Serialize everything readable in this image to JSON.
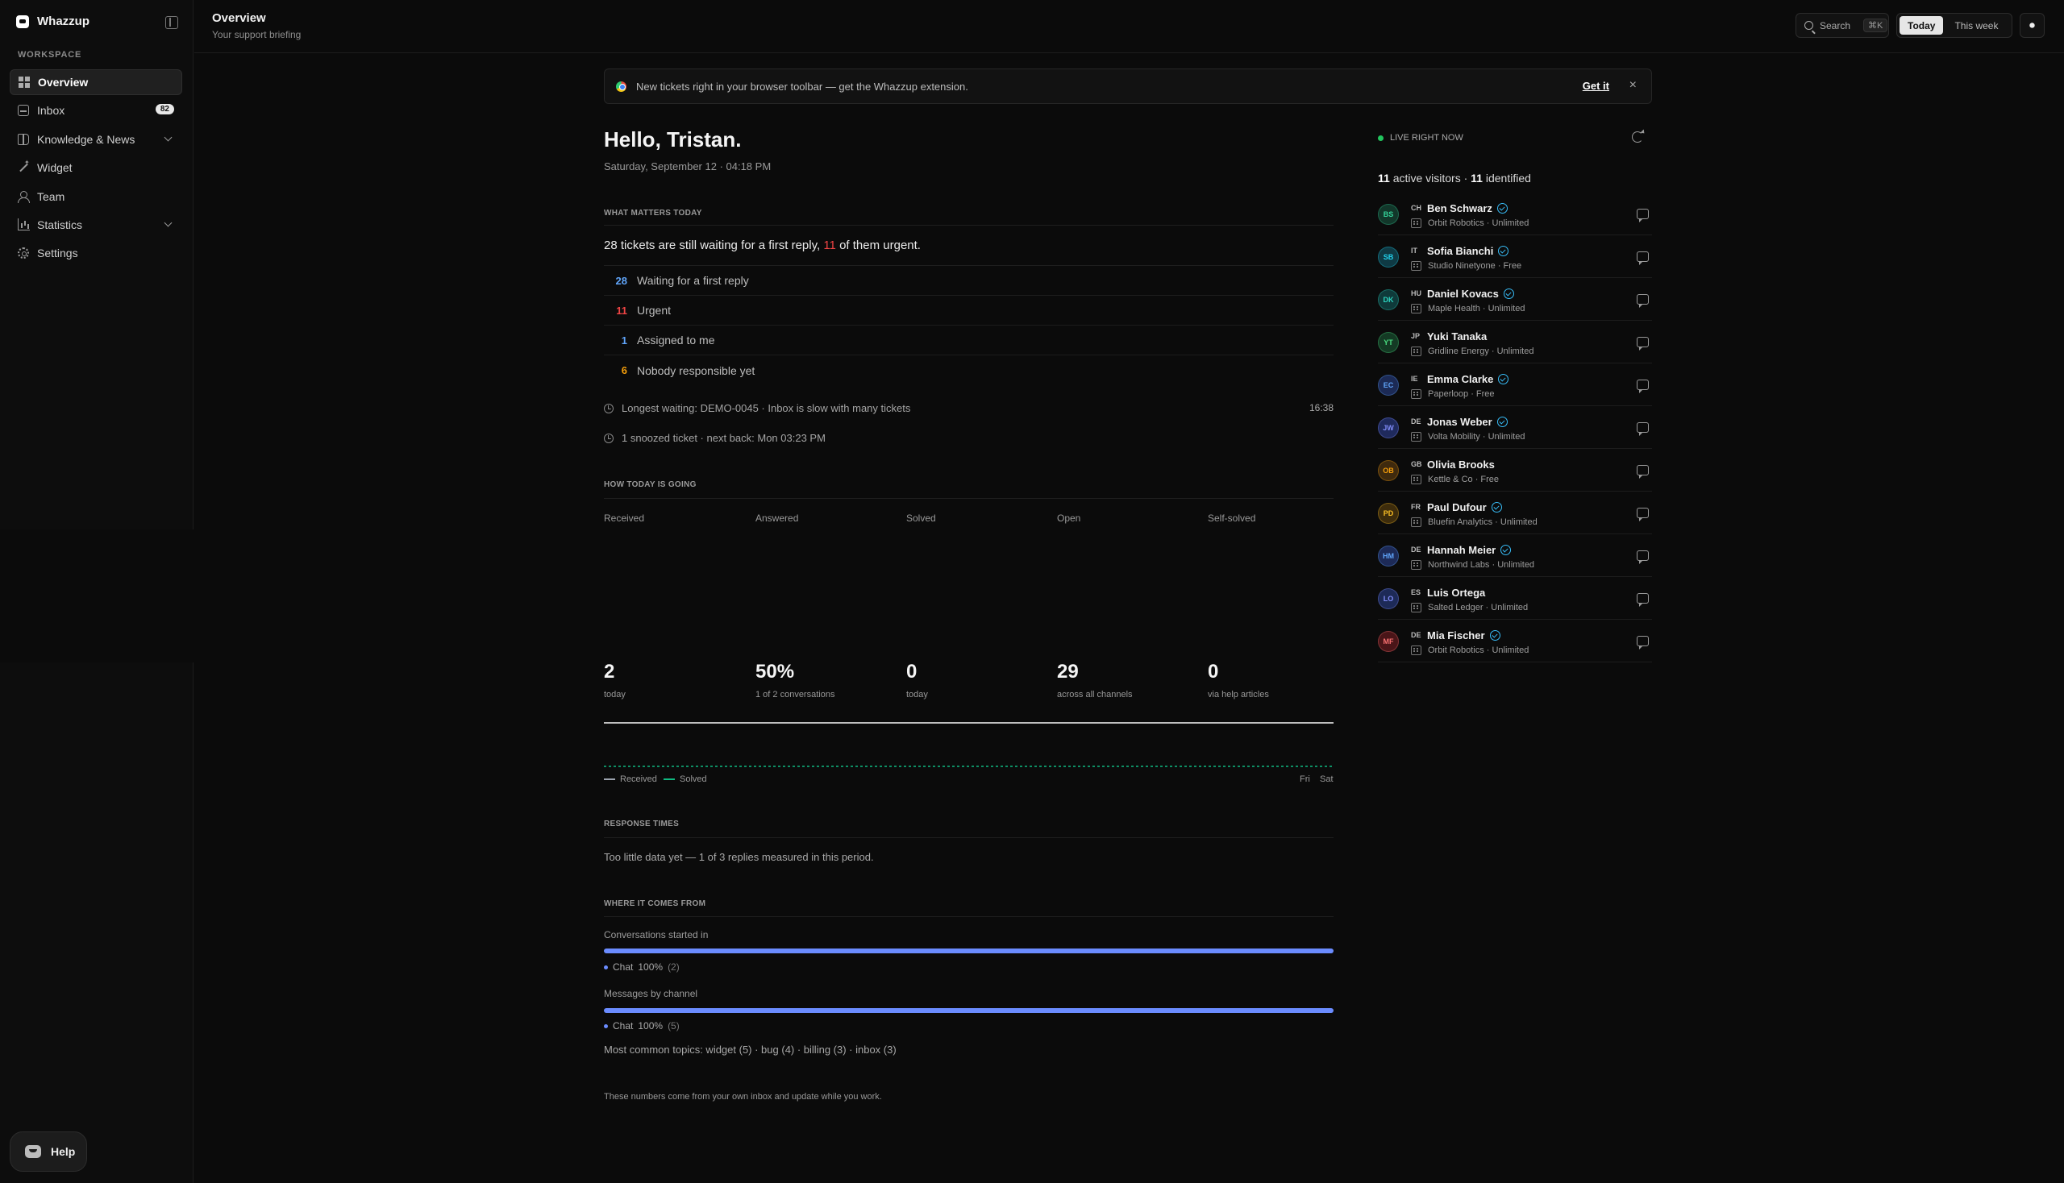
{
  "app": {
    "name": "Whazzup"
  },
  "sidebar": {
    "section_label": "WORKSPACE",
    "items": [
      {
        "label": "Overview",
        "icon": "grid-icon",
        "active": true
      },
      {
        "label": "Inbox",
        "icon": "inbox-icon",
        "badge": "82"
      },
      {
        "label": "Knowledge & News",
        "icon": "book-icon",
        "expandable": true
      },
      {
        "label": "Widget",
        "icon": "wand-icon"
      },
      {
        "label": "Team",
        "icon": "team-icon"
      },
      {
        "label": "Statistics",
        "icon": "chart-icon",
        "expandable": true
      },
      {
        "label": "Settings",
        "icon": "gear-icon"
      }
    ],
    "help_label": "Help"
  },
  "header": {
    "title": "Overview",
    "subtitle": "Your support briefing",
    "search_label": "Search",
    "search_shortcut": "⌘K",
    "range_options": [
      "Today",
      "This week"
    ],
    "range_selected": "Today",
    "avatar_initials": "⬤"
  },
  "banner": {
    "text": "New tickets right in your browser toolbar — get the Whazzup extension.",
    "cta": "Get it",
    "close": "×"
  },
  "greeting": "Hello, Tristan.",
  "date_line": "Saturday, September 12 · 04:18 PM",
  "matters": {
    "title": "WHAT MATTERS TODAY",
    "headline_a": "28 tickets are still waiting for a first reply, ",
    "headline_urgent": "11",
    "headline_b": " of them urgent.",
    "rows": [
      {
        "num": "28",
        "label": "Waiting for a first reply",
        "color": "#60a5fa"
      },
      {
        "num": "11",
        "label": "Urgent",
        "color": "#ef4444"
      },
      {
        "num": "1",
        "label": "Assigned to me",
        "color": "#60a5fa"
      },
      {
        "num": "6",
        "label": "Nobody responsible yet",
        "color": "#f59e0b"
      }
    ],
    "longest_waiting": "Longest waiting: DEMO-0045 · Inbox is slow with many tickets",
    "longest_time": "16:38",
    "snoozed": "1 snoozed ticket · next back: Mon 03:23 PM"
  },
  "today": {
    "title": "HOW TODAY IS GOING",
    "stats": [
      {
        "head": "Received",
        "value": "2",
        "sub": "today"
      },
      {
        "head": "Answered",
        "value": "50%",
        "sub": "1 of 2 conversations"
      },
      {
        "head": "Solved",
        "value": "0",
        "sub": "today"
      },
      {
        "head": "Open",
        "value": "29",
        "sub": "across all channels"
      },
      {
        "head": "Self-solved",
        "value": "0",
        "sub": "via help articles"
      }
    ],
    "legend": [
      {
        "label": "Received",
        "color": "#9ca3af"
      },
      {
        "label": "Solved",
        "color": "#10b981"
      }
    ],
    "days": [
      "Fri",
      "Sat"
    ]
  },
  "response": {
    "title": "RESPONSE TIMES",
    "text": "Too little data yet — 1 of 3 replies measured in this period."
  },
  "sources": {
    "title": "WHERE IT COMES FROM",
    "started_label": "Conversations started in",
    "started_legend": {
      "name": "Chat",
      "pct": "100%",
      "count": "(2)"
    },
    "messages_label": "Messages by channel",
    "messages_legend": {
      "name": "Chat",
      "pct": "100%",
      "count": "(5)"
    },
    "bar_color": "#6b8cff",
    "topics": "Most common topics: widget (5) · bug (4) · billing (3) · inbox (3)"
  },
  "footnote": "These numbers come from your own inbox and update while you work.",
  "live": {
    "label": "LIVE RIGHT NOW",
    "summary_active": "11",
    "summary_mid": " active visitors · ",
    "summary_identified": "11",
    "summary_end": " identified",
    "visitors": [
      {
        "initials": "BS",
        "country": "CH",
        "name": "Ben Schwarz",
        "verified": true,
        "company": "Orbit Robotics · Unlimited",
        "bg": "#12372a",
        "fg": "#34d399"
      },
      {
        "initials": "SB",
        "country": "IT",
        "name": "Sofia Bianchi",
        "verified": true,
        "company": "Studio Ninetyone · Free",
        "bg": "#0f3a44",
        "fg": "#22d3ee"
      },
      {
        "initials": "DK",
        "country": "HU",
        "name": "Daniel Kovacs",
        "verified": true,
        "company": "Maple Health · Unlimited",
        "bg": "#0f3a3a",
        "fg": "#2dd4bf"
      },
      {
        "initials": "YT",
        "country": "JP",
        "name": "Yuki Tanaka",
        "verified": false,
        "company": "Gridline Energy · Unlimited",
        "bg": "#143a24",
        "fg": "#4ade80"
      },
      {
        "initials": "EC",
        "country": "IE",
        "name": "Emma Clarke",
        "verified": true,
        "company": "Paperloop · Free",
        "bg": "#1c2a55",
        "fg": "#60a5fa"
      },
      {
        "initials": "JW",
        "country": "DE",
        "name": "Jonas Weber",
        "verified": true,
        "company": "Volta Mobility · Unlimited",
        "bg": "#1f2a5c",
        "fg": "#818cf8"
      },
      {
        "initials": "OB",
        "country": "GB",
        "name": "Olivia Brooks",
        "verified": false,
        "company": "Kettle & Co · Free",
        "bg": "#3f2a0e",
        "fg": "#f59e0b"
      },
      {
        "initials": "PD",
        "country": "FR",
        "name": "Paul Dufour",
        "verified": true,
        "company": "Bluefin Analytics · Unlimited",
        "bg": "#3d2c0c",
        "fg": "#fbbf24"
      },
      {
        "initials": "HM",
        "country": "DE",
        "name": "Hannah Meier",
        "verified": true,
        "company": "Northwind Labs · Unlimited",
        "bg": "#1d2a57",
        "fg": "#60a5fa"
      },
      {
        "initials": "LO",
        "country": "ES",
        "name": "Luis Ortega",
        "verified": false,
        "company": "Salted Ledger · Unlimited",
        "bg": "#1d2a57",
        "fg": "#818cf8"
      },
      {
        "initials": "MF",
        "country": "DE",
        "name": "Mia Fischer",
        "verified": true,
        "company": "Orbit Robotics · Unlimited",
        "bg": "#4a1518",
        "fg": "#f87171"
      }
    ]
  }
}
